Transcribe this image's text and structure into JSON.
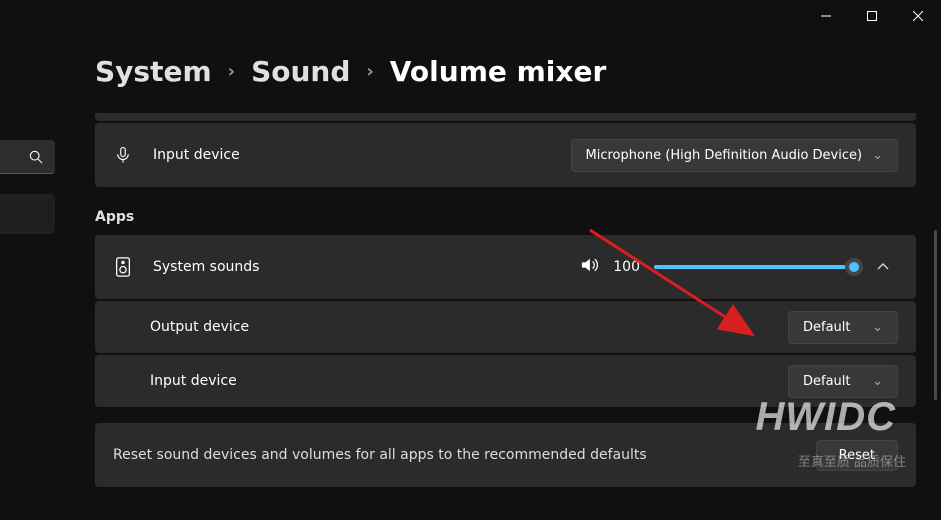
{
  "breadcrumb": {
    "system": "System",
    "sound": "Sound",
    "current": "Volume mixer"
  },
  "input_card": {
    "label": "Input device",
    "value": "Microphone (High Definition Audio Device)"
  },
  "apps_header": "Apps",
  "system_sounds": {
    "label": "System sounds",
    "volume": "100",
    "slider_pct": 100
  },
  "sub_output": {
    "label": "Output device",
    "value": "Default"
  },
  "sub_input": {
    "label": "Input device",
    "value": "Default"
  },
  "reset": {
    "text": "Reset sound devices and volumes for all apps to the recommended defaults",
    "button": "Reset"
  },
  "watermark1": "HWIDC",
  "watermark2": "至真至质 品质保住"
}
